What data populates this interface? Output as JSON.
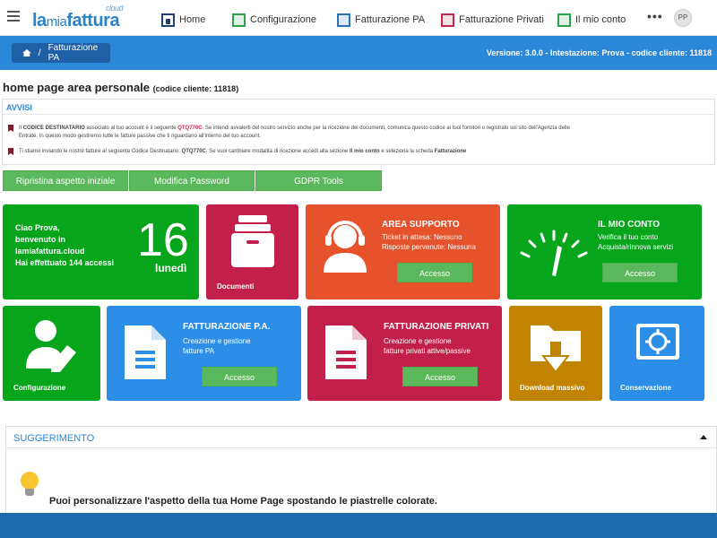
{
  "logo": {
    "part1": "la",
    "part2": "mia",
    "part3": "fattura",
    "sup": "cloud"
  },
  "nav": [
    {
      "label": "Home",
      "icon": "home-icon"
    },
    {
      "label": "Configurazione",
      "icon": "settings-icon"
    },
    {
      "label": "Fatturazione PA",
      "icon": "invoice-pa-icon"
    },
    {
      "label": "Fatturazione Privati",
      "icon": "invoice-private-icon"
    },
    {
      "label": "Il mio conto",
      "icon": "gauge-icon"
    }
  ],
  "more": "•••",
  "avatar": "PP",
  "breadcrumb": {
    "sep": "/",
    "label": "Fatturazione PA"
  },
  "version_text": "Versione: 3.0.0 - Intestazione: Prova - codice cliente: 11818",
  "page": {
    "title": "home page area personale",
    "code": "(codice cliente: 11818)"
  },
  "avvisi": {
    "header": "AVVISI",
    "n1a": "Il ",
    "n1b": "CODICE DESTINATARIO",
    "n1c": " associato al tuo account è il seguente ",
    "n1code": "QTQ770C",
    "n1d": ". Se intendi avvalerti del nostro servizio anche per la ricezione dei documenti, comunica questo codice ai tuoi fornitori o registralo sul sito dell'Agenzia delle Entrate. In questo modo gestiremo tutte le fatture passive che ti riguardano all'interno del tuo account.",
    "n2a": "Ti stiamo inviando le nostre fatture al seguente Codice Destinatario: ",
    "n2code": "QTQ770C",
    "n2b": ". Se vuoi cambiare modalità di ricezione accedi alla sezione ",
    "n2c": "Il mio conto",
    "n2d": " e seleziona la scheda ",
    "n2e": "Fatturazione"
  },
  "buttons": {
    "reset": "Ripristina aspetto iniziale",
    "password": "Modifica Password",
    "gdpr": "GDPR Tools"
  },
  "welcome": {
    "l1": "Ciao ",
    "name": "Prova",
    "l2": "benvenuto in",
    "l3": "lamiafattura.cloud",
    "l4": "Hai effettuato 144 accessi",
    "day_num": "16",
    "day_name": "lunedì"
  },
  "tiles": {
    "documenti": "Documenti",
    "supporto": {
      "title": "AREA SUPPORTO",
      "s1": "Ticket in attesa: Nessuno",
      "s2": "Risposte pervenute: Nessuna",
      "btn": "Accesso"
    },
    "conto": {
      "title": "IL MIO CONTO",
      "s1": "Verifica il tuo conto",
      "s2": "Acquista/rinnova servizi",
      "btn": "Accesso"
    },
    "configurazione": "Configurazione",
    "pa": {
      "title": "FATTURAZIONE P.A.",
      "s1": "Creazione e gestione",
      "s2": "fatture PA",
      "btn": "Accesso"
    },
    "privati": {
      "title": "FATTURAZIONE PRIVATI",
      "s1": "Creazione e gestione",
      "s2": "fatture privati attive/passive",
      "btn": "Accesso"
    },
    "download": "Download massivo",
    "conservazione": "Conservazione"
  },
  "suggerimento": {
    "header": "SUGGERIMENTO",
    "text": "Puoi personalizzare l'aspetto della tua Home Page spostando le piastrelle colorate."
  },
  "colors": {
    "green": "#07a51b",
    "crimson": "#c2204a",
    "orange": "#e5522b",
    "blue": "#2d8ee8",
    "amber": "#c28300",
    "band": "#2b88d8"
  }
}
